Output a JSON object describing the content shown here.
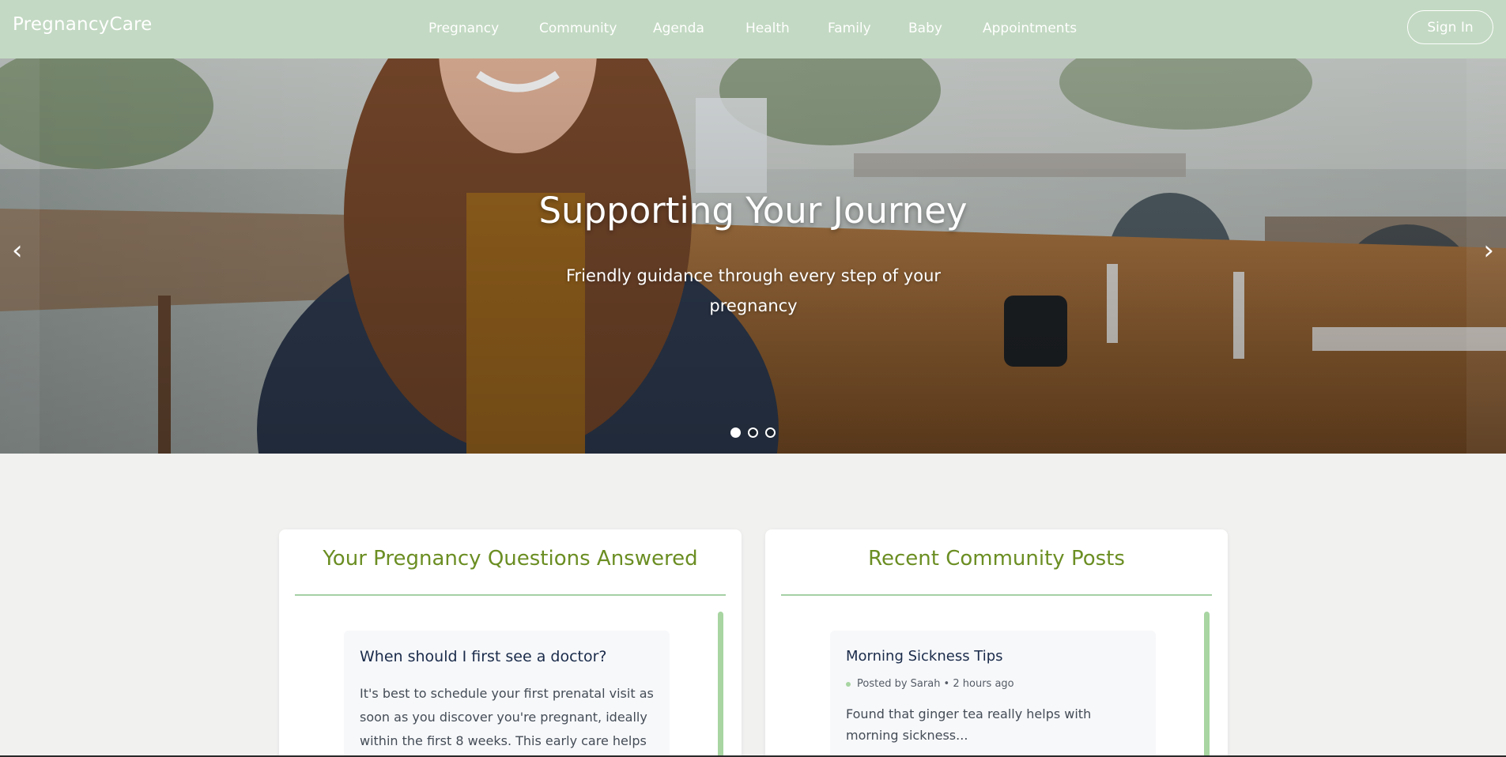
{
  "brand": "PregnancyCare",
  "nav": {
    "items": [
      "Pregnancy",
      "Community",
      "Agenda",
      "Health",
      "Family",
      "Baby",
      "Appointments"
    ],
    "sign_in": "Sign In"
  },
  "hero": {
    "title": "Supporting Your Journey",
    "subtitle": "Friendly guidance through every step of your pregnancy",
    "prev_arrow": "‹",
    "next_arrow": "›",
    "slide_count": 3,
    "active_slide": 1
  },
  "questions_card": {
    "title": "Your Pregnancy Questions Answered",
    "item_title": "When should I first see a doctor?",
    "item_text": "It's best to schedule your first prenatal visit as soon as you discover you're pregnant, ideally within the first 8 weeks. This early care helps"
  },
  "community_card": {
    "title": "Recent Community Posts",
    "post_title": "Morning Sickness Tips",
    "post_meta": "Posted by Sarah • 2 hours ago",
    "post_text": "Found that ginger tea really helps with morning sickness..."
  },
  "colors": {
    "navbar": "#c3d9c3",
    "accent_green": "#6b8e23",
    "soft_green": "#a8d5a2",
    "background": "#f1f1f0"
  }
}
